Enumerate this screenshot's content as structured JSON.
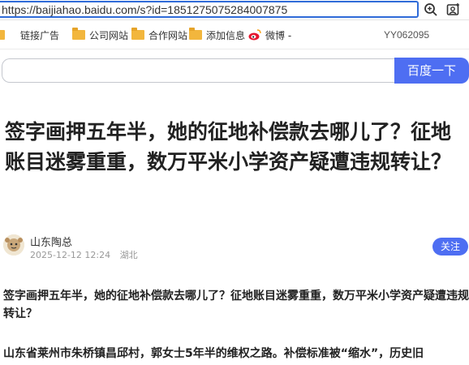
{
  "address_bar": {
    "url": "https://baijiahao.baidu.com/s?id=1851275075284007875"
  },
  "bookmarks": {
    "items": [
      {
        "label": "链接广告"
      },
      {
        "label": "公司网站"
      },
      {
        "label": "合作网站"
      },
      {
        "label": "添加信息"
      },
      {
        "label": "微博 -"
      }
    ],
    "user_code": "YY062095"
  },
  "search": {
    "button_label": "百度一下",
    "placeholder": ""
  },
  "article": {
    "title": "签字画押五年半，她的征地补偿款去哪儿了？征地账目迷雾重重，数万平米小学资产疑遭违规转让？",
    "author": "山东陶总",
    "date": "2025-12-12 12:24",
    "location": "湖北",
    "follow_label": "关注",
    "summary": "签字画押五年半，她的征地补偿款去哪儿了？征地账目迷雾重重，数万平米小学资产疑遭违规转让？",
    "paragraph": "山东省莱州市朱桥镇昌邱村，郭女士5年半的维权之路。补偿标准被“缩水”，历史旧"
  },
  "colors": {
    "accent": "#4e6ef2",
    "folder": "#f2b63d"
  }
}
